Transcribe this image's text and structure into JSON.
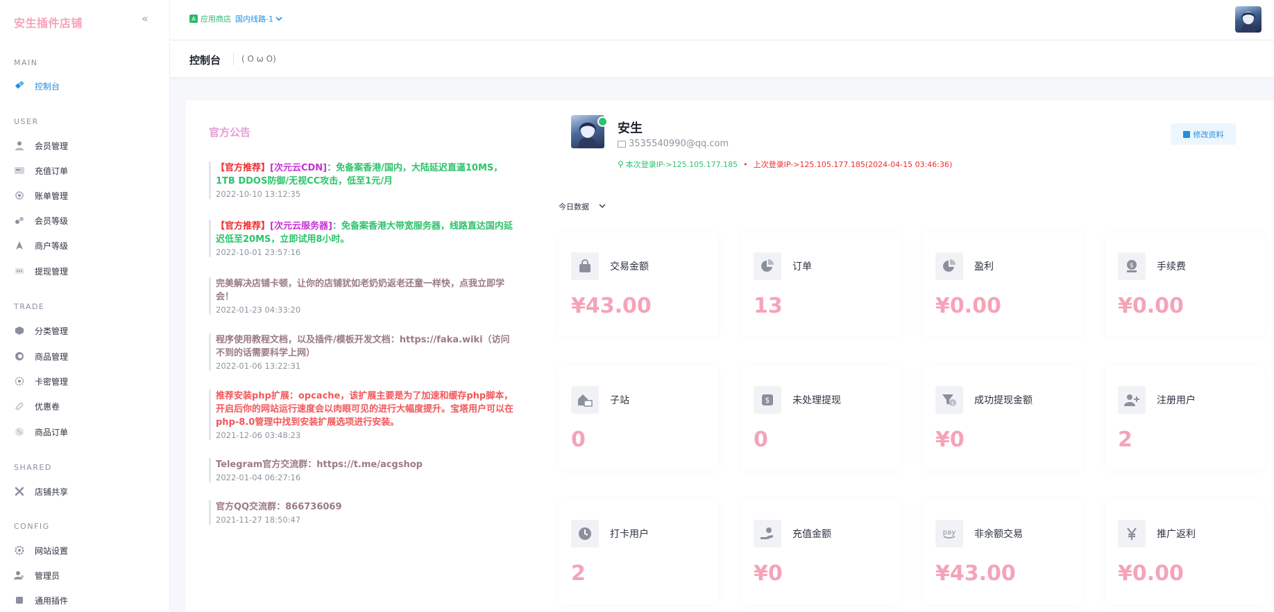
{
  "sidebar": {
    "brand": "安生插件店铺",
    "sections": [
      {
        "title": "MAIN",
        "items": [
          {
            "label": "控制台",
            "icon": "dashboard-icon",
            "active": true
          }
        ]
      },
      {
        "title": "USER",
        "items": [
          {
            "label": "会员管理",
            "icon": "user-icon"
          },
          {
            "label": "充值订单",
            "icon": "recharge-icon"
          },
          {
            "label": "账单管理",
            "icon": "bill-icon"
          },
          {
            "label": "会员等级",
            "icon": "level-icon"
          },
          {
            "label": "商户等级",
            "icon": "merchant-icon"
          },
          {
            "label": "提现管理",
            "icon": "withdraw-icon"
          }
        ]
      },
      {
        "title": "TRADE",
        "items": [
          {
            "label": "分类管理",
            "icon": "category-icon"
          },
          {
            "label": "商品管理",
            "icon": "goods-icon"
          },
          {
            "label": "卡密管理",
            "icon": "card-icon"
          },
          {
            "label": "优惠卷",
            "icon": "coupon-icon"
          },
          {
            "label": "商品订单",
            "icon": "order-icon"
          }
        ]
      },
      {
        "title": "SHARED",
        "items": [
          {
            "label": "店铺共享",
            "icon": "share-icon"
          }
        ]
      },
      {
        "title": "CONFIG",
        "items": [
          {
            "label": "网站设置",
            "icon": "settings-icon"
          },
          {
            "label": "管理员",
            "icon": "admin-icon"
          },
          {
            "label": "通用插件",
            "icon": "plugin-icon"
          }
        ]
      }
    ]
  },
  "topbar": {
    "store_label": "应用商店",
    "line_label": "国内线路-1"
  },
  "subbar": {
    "title": "控制台",
    "subtitle": "( O ω O)"
  },
  "announcements": {
    "title": "官方公告",
    "items": [
      {
        "parts": [
          {
            "text": "【官方推荐】",
            "color": "red"
          },
          {
            "text": "[次元云CDN]",
            "color": "mag"
          },
          {
            "text": "：免备案香港/国内，大陆延迟直逼10MS，1TB DDOS防御/无视CC攻击，低至1元/月",
            "color": "green"
          }
        ],
        "time": "2022-10-10 13:12:35"
      },
      {
        "parts": [
          {
            "text": "【官方推荐】",
            "color": "red"
          },
          {
            "text": "[次元云服务器]",
            "color": "mag"
          },
          {
            "text": "：免备案香港大带宽服务器，线路直达国内延迟低至20MS，立即试用8小时。",
            "color": "green"
          }
        ],
        "time": "2022-10-01 23:57:16"
      },
      {
        "parts": [
          {
            "text": "完美解决店铺卡顿，让你的店铺犹如老奶奶返老还童一样快，点我立即学会！",
            "color": "brown"
          }
        ],
        "time": "2022-01-23 04:33:20"
      },
      {
        "parts": [
          {
            "text": "程序使用教程文档，以及插件/模板开发文档：https://faka.wiki（访问不到的话需要科学上网）",
            "color": "brown"
          }
        ],
        "time": "2022-01-06 13:22:31"
      },
      {
        "parts": [
          {
            "text": "推荐安装php扩展：opcache，该扩展主要是为了加速和缓存php脚本，开启后你的网站运行速度会以肉眼可见的进行大幅度提升。宝塔用户可以在php-8.0管理中找到安装扩展选项进行安装。",
            "color": "salmon"
          }
        ],
        "time": "2021-12-06 03:48:23"
      },
      {
        "parts": [
          {
            "text": "Telegram官方交流群：https://t.me/acgshop",
            "color": "brown"
          }
        ],
        "time": "2022-01-04 06:27:16"
      },
      {
        "parts": [
          {
            "text": "官方QQ交流群：866736069",
            "color": "brown"
          }
        ],
        "time": "2021-11-27 18:50:47"
      }
    ]
  },
  "profile": {
    "name": "安生",
    "email": "3535540990@qq.com",
    "current_ip": "本次登录IP->125.105.177.185",
    "last_ip": "上次登录IP->125.105.177.185(2024-04-15 03:46:36)",
    "edit_label": "修改资料"
  },
  "today_label": "今日数据",
  "stats": [
    {
      "label": "交易金额",
      "value": "¥43.00",
      "icon": "bag-icon"
    },
    {
      "label": "订单",
      "value": "13",
      "icon": "pie-chart-icon"
    },
    {
      "label": "盈利",
      "value": "¥0.00",
      "icon": "pie-chart-icon"
    },
    {
      "label": "手续费",
      "value": "¥0.00",
      "icon": "money-icon"
    },
    {
      "label": "子站",
      "value": "0",
      "icon": "house-icon"
    },
    {
      "label": "未处理提现",
      "value": "0",
      "icon": "dollar-icon"
    },
    {
      "label": "成功提现金额",
      "value": "¥0",
      "icon": "funnel-dollar-icon"
    },
    {
      "label": "注册用户",
      "value": "2",
      "icon": "user-plus-icon"
    },
    {
      "label": "打卡用户",
      "value": "2",
      "icon": "clock-icon"
    },
    {
      "label": "充值金额",
      "value": "¥0",
      "icon": "hand-money-icon"
    },
    {
      "label": "非余额交易",
      "value": "¥43.00",
      "icon": "pay-icon"
    },
    {
      "label": "推广返利",
      "value": "¥0.00",
      "icon": "yen-icon"
    }
  ]
}
